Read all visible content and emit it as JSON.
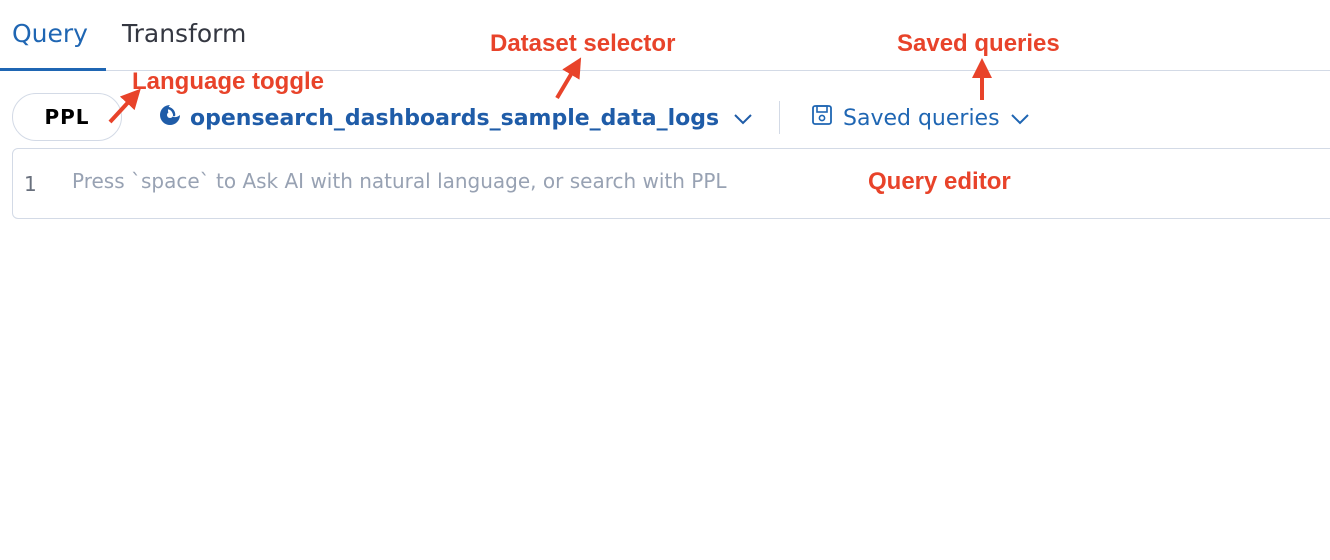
{
  "tabs": [
    {
      "label": "Query",
      "active": true
    },
    {
      "label": "Transform",
      "active": false
    }
  ],
  "toolbar": {
    "language_label": "PPL",
    "dataset_label": "opensearch_dashboards_sample_data_logs",
    "dataset_icon": "opensearch-logo-icon",
    "saved_queries_label": "Saved queries",
    "saved_queries_icon": "save-icon"
  },
  "editor": {
    "line_number": "1",
    "value": "",
    "placeholder": "Press `space` to Ask AI with natural language, or search with PPL"
  },
  "annotations": {
    "language_toggle": "Language toggle",
    "dataset_selector": "Dataset selector",
    "saved_queries": "Saved queries",
    "query_editor": "Query editor"
  },
  "colors": {
    "accent": "#1f66b3",
    "annotation": "#e8432a",
    "border": "#d3dae6"
  }
}
